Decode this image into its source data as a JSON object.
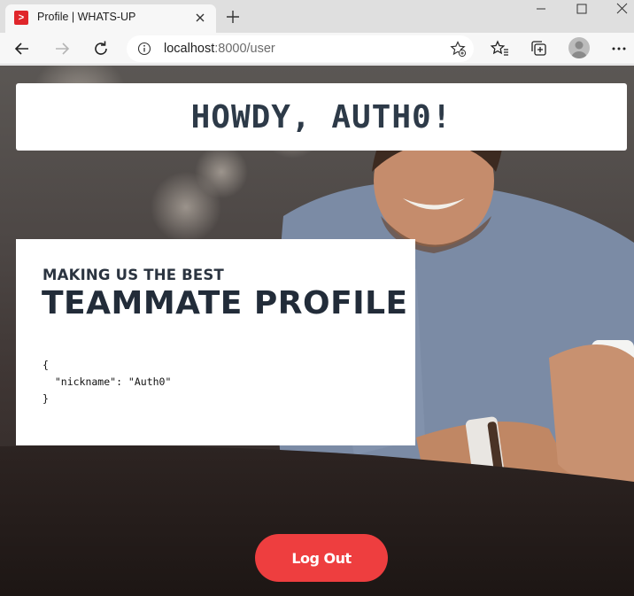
{
  "browser": {
    "tab_title": "Profile | WHATS-UP",
    "url_host": "localhost",
    "url_rest": ":8000/user"
  },
  "page": {
    "greeting": "HOWDY, AUTH0!",
    "profile": {
      "kicker": "MAKING US THE BEST",
      "title": "TEAMMATE PROFILE",
      "json_text": "{\n  \"nickname\": \"Auth0\"\n}"
    },
    "logout_label": "Log Out"
  },
  "colors": {
    "accent": "#ee3e3f",
    "heading": "#222c39"
  },
  "icons": {
    "favicon": "app-favicon-icon",
    "back": "back-arrow-icon",
    "forward": "forward-arrow-icon",
    "refresh": "refresh-icon",
    "info": "info-icon",
    "add_favorite": "add-favorite-icon",
    "favorites": "favorites-icon",
    "collections": "collections-icon",
    "profile": "profile-avatar-icon",
    "more": "more-menu-icon"
  }
}
